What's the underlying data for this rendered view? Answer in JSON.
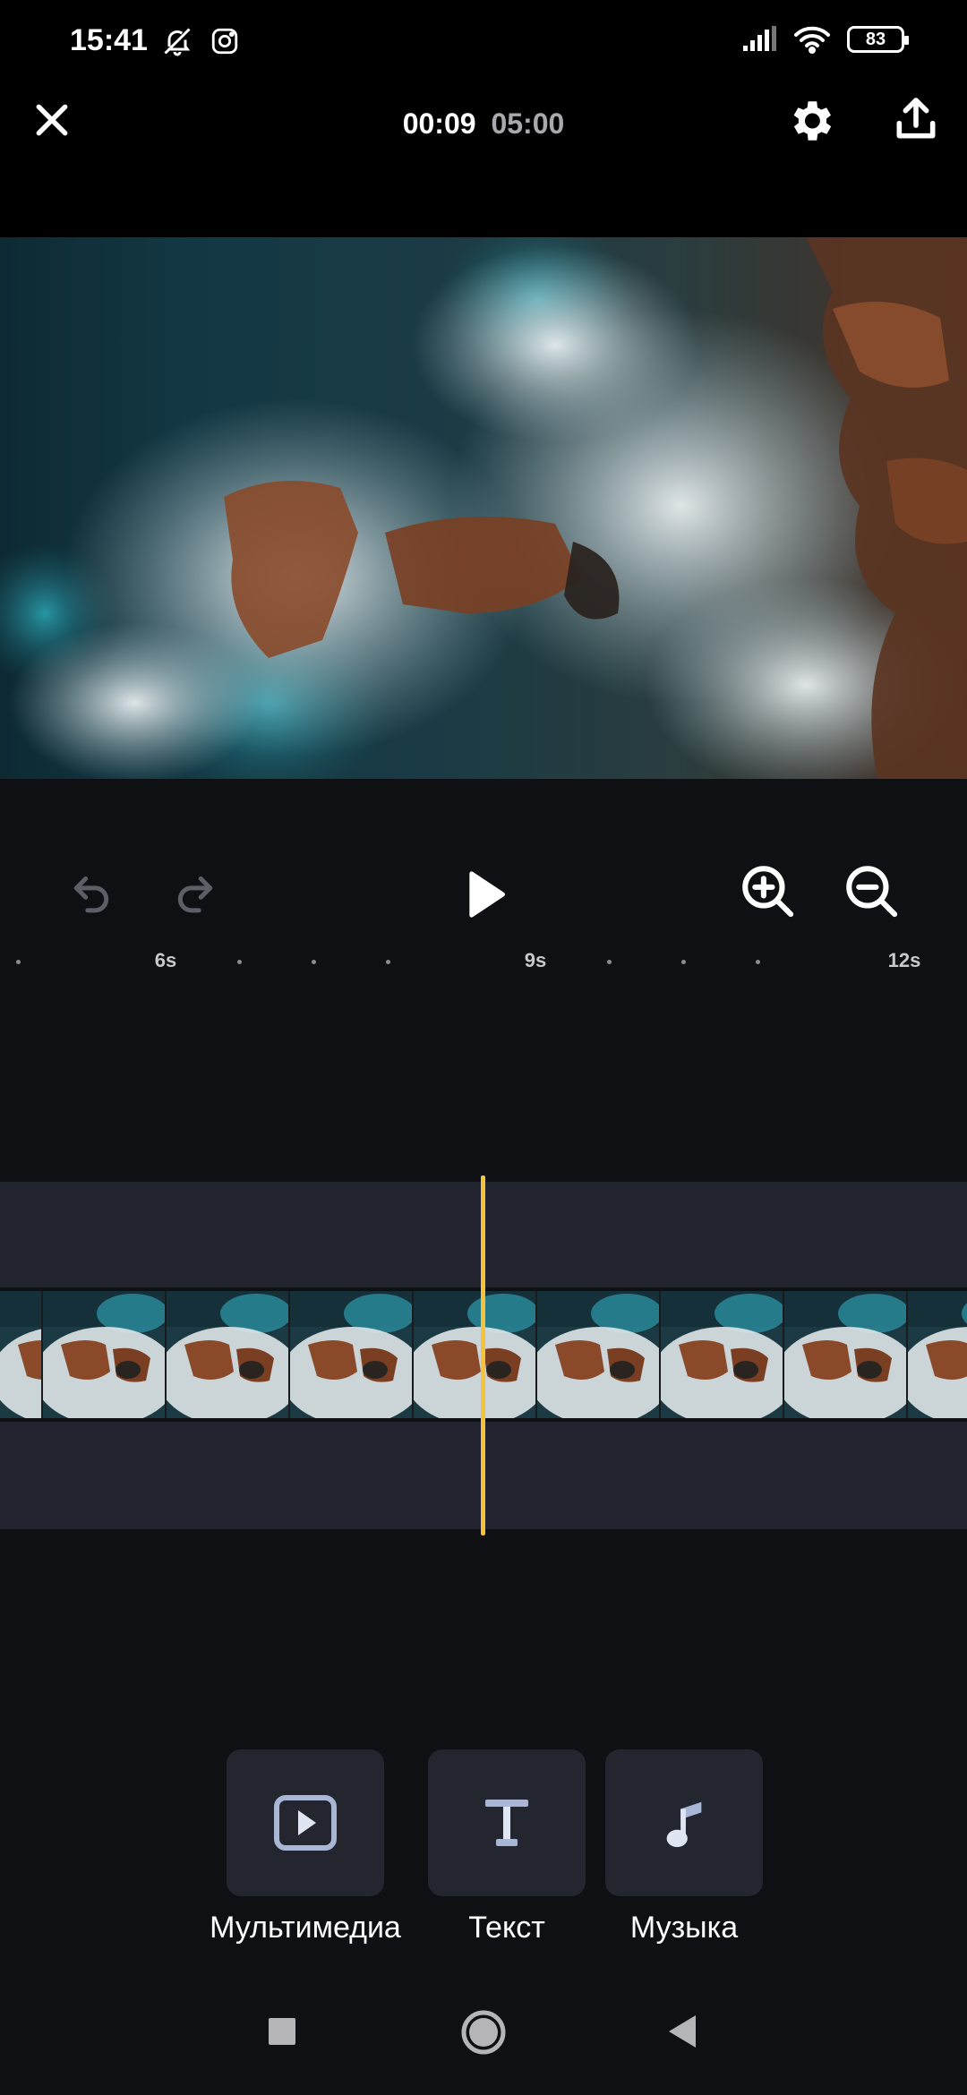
{
  "status": {
    "time": "15:41",
    "battery": "83",
    "left_icons": [
      "bell-muted-icon",
      "instagram-icon"
    ],
    "right_icons": [
      "signal-icon",
      "wifi-icon",
      "battery-icon"
    ]
  },
  "header": {
    "current_time": "00:09",
    "total_time": "05:00",
    "icons": [
      "close-icon",
      "gear-icon",
      "share-icon"
    ]
  },
  "timeline": {
    "ruler_labels": [
      "6s",
      "9s",
      "12s"
    ],
    "playhead_color": "#f5c33b"
  },
  "tools": [
    {
      "label": "Мультимедиа",
      "icon": "media-play-icon"
    },
    {
      "label": "Текст",
      "icon": "text-icon"
    },
    {
      "label": "Музыка",
      "icon": "music-note-icon"
    }
  ],
  "colors": {
    "accent": "#f5c33b",
    "panel": "#23262f",
    "background": "#0f1013"
  }
}
